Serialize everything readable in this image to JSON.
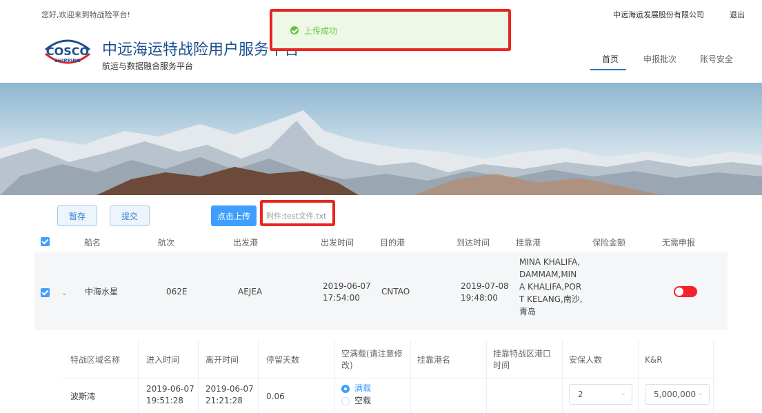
{
  "topbar": {
    "welcome": "您好,欢迎来到特战险平台!",
    "company": "中远海运发展股份有限公司",
    "logout": "退出"
  },
  "header": {
    "logo_top": "COSCO",
    "logo_bottom": "SHIPPING",
    "title": "中远海运特战险用户服务平台",
    "subtitle": "航运与数据融合服务平台",
    "nav": {
      "home": "首页",
      "batch": "申报批次",
      "security": "账号安全"
    }
  },
  "toast": {
    "message": "上传成功"
  },
  "toolbar": {
    "save": "暂存",
    "submit": "提交",
    "upload": "点击上传",
    "attachment": "附件:test文件.txt"
  },
  "table": {
    "headers": {
      "ship": "船名",
      "voyage": "航次",
      "departure_port": "出发港",
      "departure_time": "出发时间",
      "destination": "目的港",
      "arrival_time": "到达时间",
      "call_port": "挂靠港",
      "amount": "保险金额",
      "no_report": "无需申报"
    },
    "row": {
      "ship": "中海水星",
      "voyage": "062E",
      "departure_port": "AEJEA",
      "departure_date": "2019-06-07",
      "departure_clock": "17:54:00",
      "destination": "CNTAO",
      "arrival_date": "2019-07-08",
      "arrival_clock": "19:48:00",
      "call_port_lines": [
        "MINA KHALIFA,",
        "DAMMAM,MIN",
        "A KHALIFA,POR",
        "T KELANG,南沙,",
        "青岛"
      ],
      "no_report_toggle": "on"
    }
  },
  "subtable": {
    "headers": {
      "zone": "特战区域名称",
      "enter": "进入时间",
      "leave": "离开时间",
      "days": "停留天数",
      "load_line1": "空满载(请注意修",
      "load_line2": "改)",
      "call_port": "挂靠港名",
      "war_port_line1": "挂靠特战区港口",
      "war_port_line2": "时间",
      "guards": "安保人数",
      "kr": "K&R"
    },
    "row": {
      "zone": "波斯湾",
      "enter_date": "2019-06-07",
      "enter_clock": "19:51:28",
      "leave_date": "2019-06-07",
      "leave_clock": "21:21:28",
      "days": "0.06",
      "load_full": "满载",
      "load_empty": "空载",
      "load_selected": "满载",
      "guards": "2",
      "kr": "5,000,000"
    }
  },
  "colors": {
    "accent": "#409eff",
    "success": "#67c23a",
    "danger": "#f5222d",
    "highlight": "#e8261f",
    "brand": "#1c4f8f"
  }
}
